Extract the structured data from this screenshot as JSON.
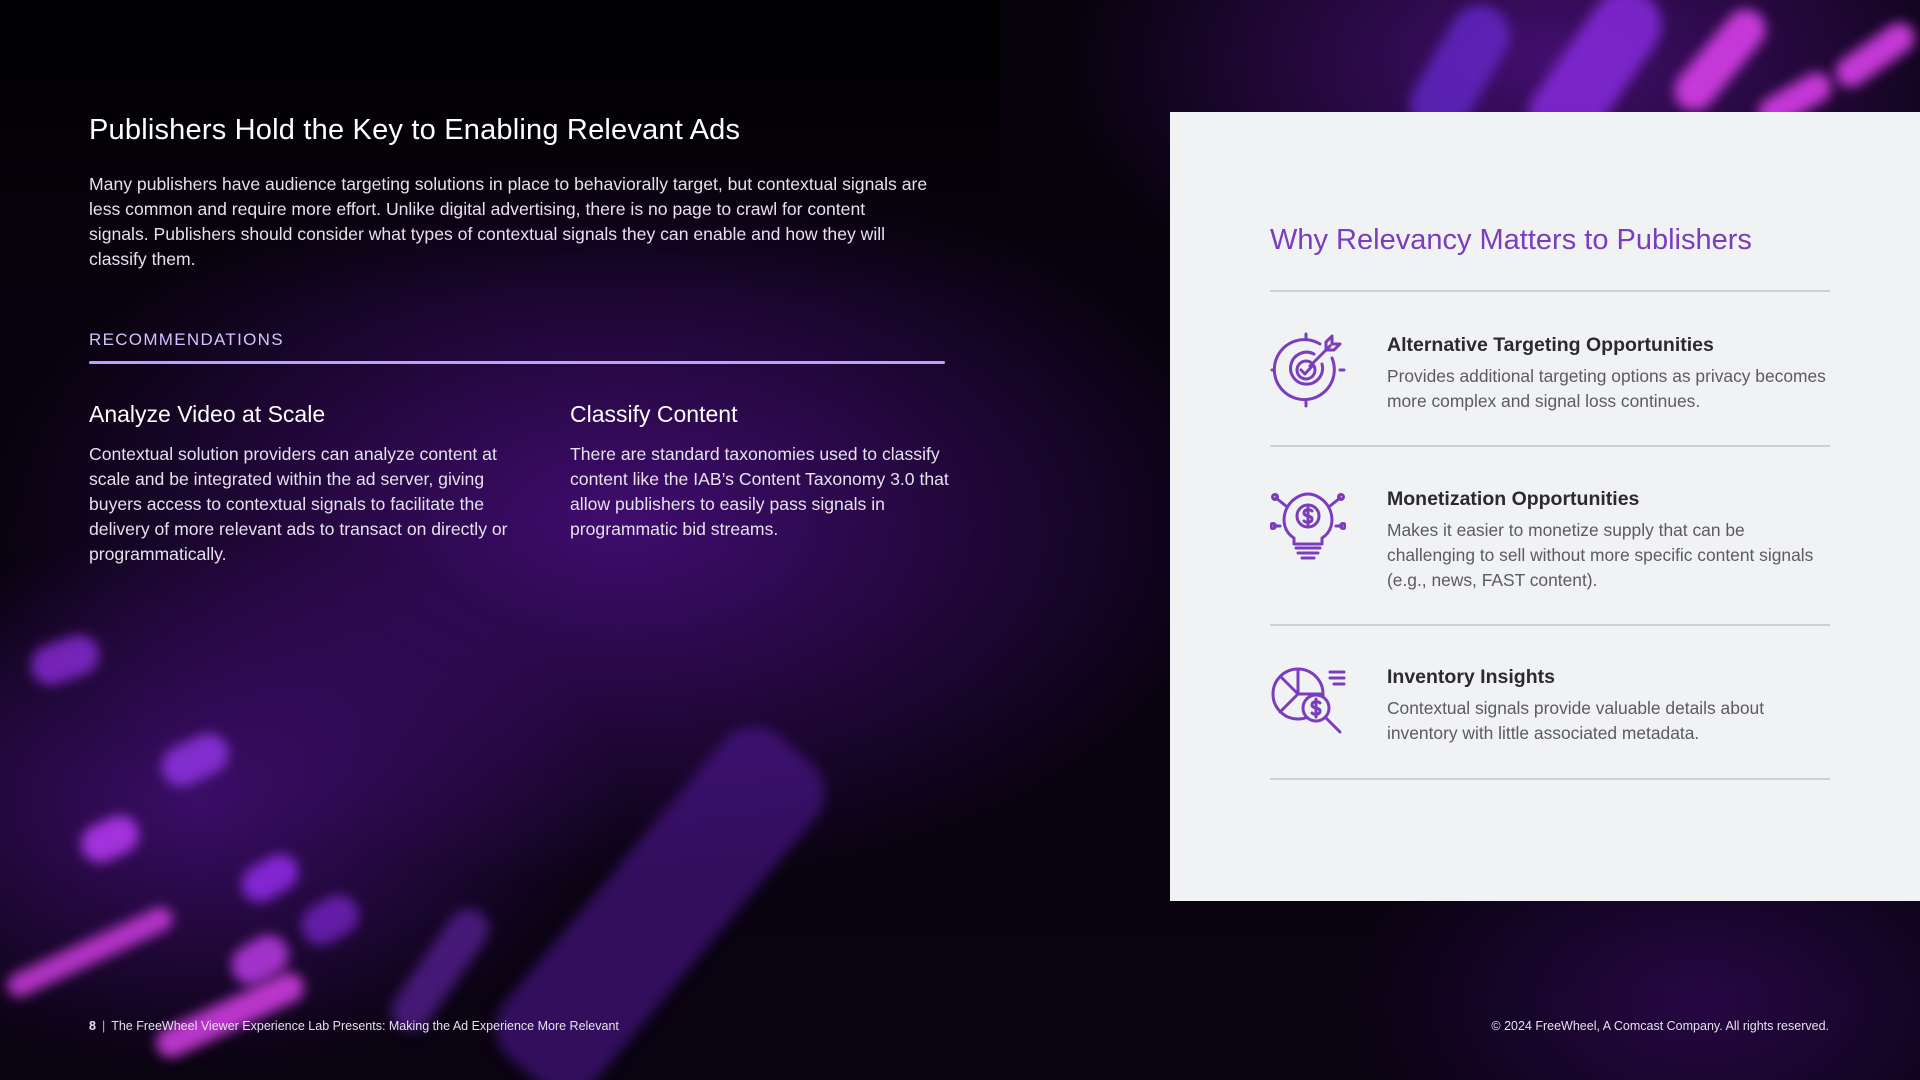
{
  "left": {
    "title": "Publishers Hold the Key to Enabling Relevant Ads",
    "intro": "Many publishers have audience targeting solutions in place to behaviorally target, but contextual signals are less common and require more effort. Unlike digital advertising, there is no page to crawl for content signals. Publishers should consider what types of contextual signals they can enable and how they will classify them.",
    "recommendations_label": "RECOMMENDATIONS",
    "columns": [
      {
        "heading": "Analyze Video at Scale",
        "body": "Contextual solution providers can analyze content at scale and be integrated within the ad server, giving buyers access to contextual signals to facilitate the delivery of more relevant ads to transact on directly or programmatically."
      },
      {
        "heading": "Classify Content",
        "body": "There are standard taxonomies used to classify content like the IAB’s Content Taxonomy 3.0 that allow publishers to easily pass signals in programmatic bid streams."
      }
    ]
  },
  "panel": {
    "title": "Why Relevancy Matters to Publishers",
    "accent_color": "#7a3dbe",
    "items": [
      {
        "icon": "target-icon",
        "heading": "Alternative Targeting Opportunities",
        "body": "Provides additional targeting options as privacy becomes more complex and signal loss continues."
      },
      {
        "icon": "lightbulb-dollar-icon",
        "heading": "Monetization Opportunities",
        "body": "Makes it easier to monetize supply that can be challenging to sell without more specific content signals (e.g., news, FAST content)."
      },
      {
        "icon": "chart-magnifier-dollar-icon",
        "heading": "Inventory Insights",
        "body": "Contextual signals provide valuable details about inventory with little associated metadata."
      }
    ]
  },
  "footer": {
    "page_number": "8",
    "separator": "|",
    "doc_title": "The FreeWheel Viewer Experience Lab Presents: Making the Ad Experience More Relevant",
    "copyright": "© 2024 FreeWheel, A Comcast Company. All rights reserved."
  }
}
